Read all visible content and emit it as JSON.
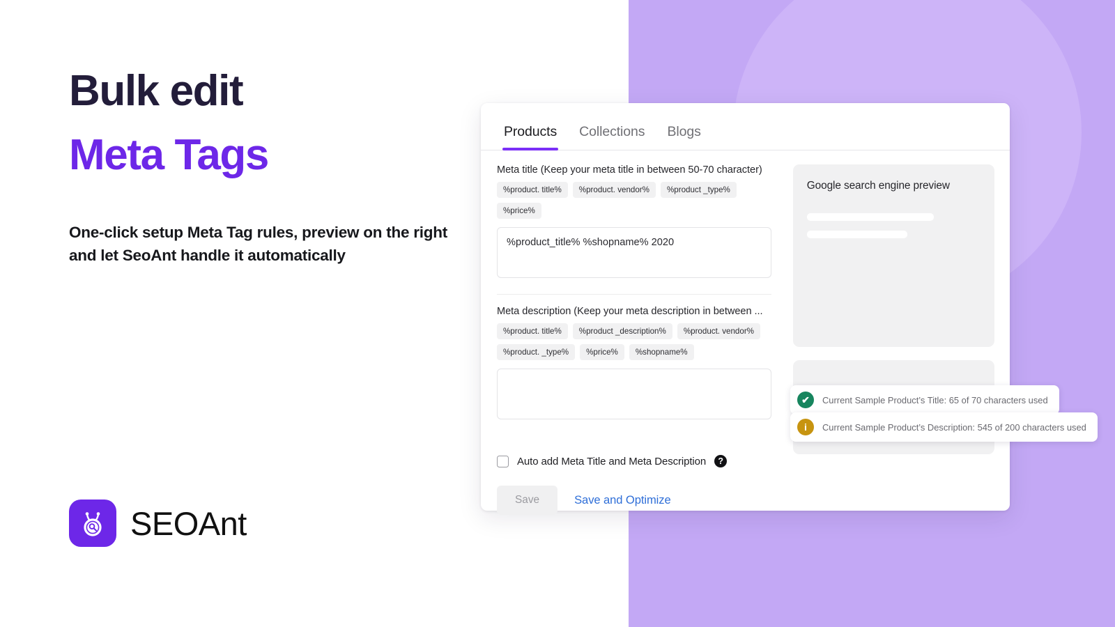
{
  "hero": {
    "title_line1": "Bulk edit",
    "title_line2": "Meta Tags",
    "subtitle": "One-click setup Meta Tag rules, preview on the right and let SeoAnt handle it automatically",
    "title_color": "#231d3a",
    "accent_color": "#6d27e8"
  },
  "logo": {
    "wordmark": "SEOAnt",
    "mark_icon": "ant-magnifier-icon",
    "mark_color": "#6d27e8"
  },
  "background": {
    "panel_color": "#c3a8f5",
    "watermark_icon": "ant-watermark-icon"
  },
  "app": {
    "tabs": [
      {
        "label": "Products",
        "active": true
      },
      {
        "label": "Collections",
        "active": false
      },
      {
        "label": "Blogs",
        "active": false
      }
    ],
    "active_tab_color": "#7b2ff7",
    "meta_title": {
      "label": "Meta title (Keep your meta title in between 50-70 character)",
      "chips": [
        "%product. title%",
        "%product. vendor%",
        "%product _type%",
        "%price%"
      ],
      "value": "%product_title% %shopname% 2020",
      "placeholder": ""
    },
    "meta_description": {
      "label": "Meta description (Keep your meta description in between ...",
      "chips": [
        "%product. title%",
        "%product _description%",
        "%product. vendor%",
        "%product. _type%",
        "%price%",
        "%shopname%"
      ],
      "value": "",
      "placeholder": ""
    },
    "auto_add": {
      "label": "Auto add Meta Title and Meta Description",
      "checked": false,
      "help_icon": "question-mark-icon",
      "help_glyph": "?"
    },
    "buttons": {
      "save": "Save",
      "save_and_optimize": "Save and Optimize",
      "optimize_color": "#2f6fd8"
    },
    "preview": {
      "title": "Google search engine preview",
      "panel_color": "#f1f1f2"
    },
    "toasts": [
      {
        "icon": "check-circle-icon",
        "glyph": "✔",
        "color": "#17855e",
        "text": "Current Sample Product’s Title: 65 of 70 characters used"
      },
      {
        "icon": "info-circle-icon",
        "glyph": "i",
        "color": "#c79410",
        "text": "Current Sample Product’s Description: 545 of 200 characters used"
      }
    ]
  }
}
